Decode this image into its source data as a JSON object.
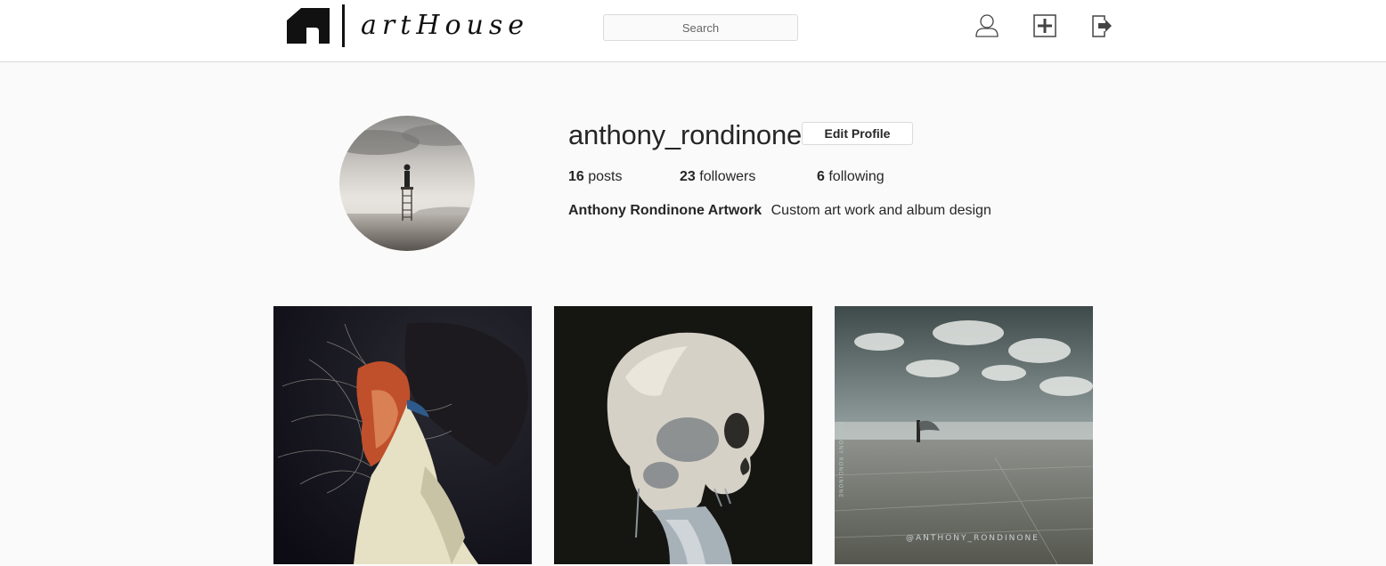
{
  "header": {
    "brand": "artHouse",
    "search_placeholder": "Search",
    "icons": [
      "profile-icon",
      "add-post-icon",
      "logout-icon"
    ]
  },
  "profile": {
    "username": "anthony_rondinone",
    "edit_button_label": "Edit Profile",
    "stats": {
      "posts_count": "16",
      "posts_label": "posts",
      "followers_count": "23",
      "followers_label": "followers",
      "following_count": "6",
      "following_label": "following"
    },
    "full_name": "Anthony Rondinone Artwork",
    "bio": "Custom art work and album design"
  },
  "posts": [
    {
      "description": "abstract portrait painting"
    },
    {
      "description": "skull painting"
    },
    {
      "description": "surreal landscape photo",
      "watermark": "@ANTHONY_RONDINONE"
    }
  ],
  "colors": {
    "page_background": "#fafafa",
    "header_background": "#ffffff",
    "border": "#dbdbdb",
    "text": "#262626"
  }
}
